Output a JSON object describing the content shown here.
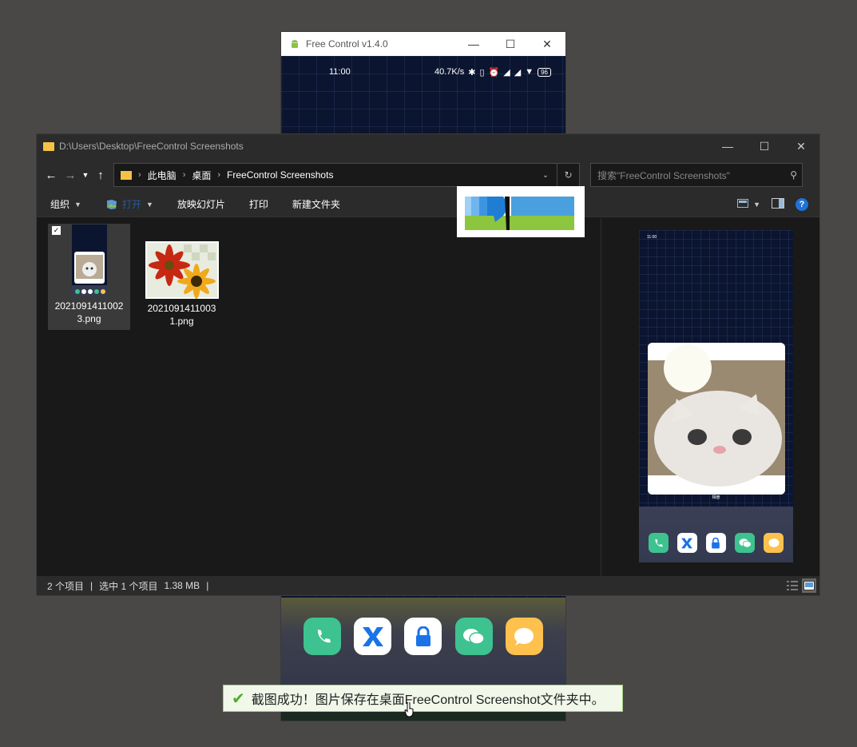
{
  "phone_window": {
    "title": "Free Control v1.4.0",
    "status_time": "11:00",
    "status_speed": "40.7K/s",
    "battery": "96",
    "dock_apps": [
      "phone-icon",
      "x-app-icon",
      "lock-app-icon",
      "wechat-icon",
      "message-icon"
    ]
  },
  "explorer": {
    "title": "D:\\Users\\Desktop\\FreeControl Screenshots",
    "breadcrumbs": [
      "此电脑",
      "桌面",
      "FreeControl Screenshots"
    ],
    "search_placeholder": "搜索\"FreeControl Screenshots\"",
    "commands": {
      "organize": "组织",
      "open": "打开",
      "slideshow": "放映幻灯片",
      "print": "打印",
      "new_folder": "新建文件夹"
    },
    "files": [
      {
        "name_line1": "2021091411002",
        "name_line2": "3.png",
        "selected": true
      },
      {
        "name_line1": "2021091411003",
        "name_line2": "1.png",
        "selected": false
      }
    ],
    "status": {
      "count": "2 个项目",
      "selection": "选中 1 个项目",
      "size": "1.38 MB"
    },
    "preview": {
      "time": "11:00",
      "caption": "相册"
    }
  },
  "toast": {
    "message": "截图成功！图片保存在桌面FreeControl Screenshot文件夹中。"
  },
  "colors": {
    "accent_green": "#4caf2c",
    "folder_yellow": "#f4c244",
    "help_blue": "#1e73d6"
  }
}
